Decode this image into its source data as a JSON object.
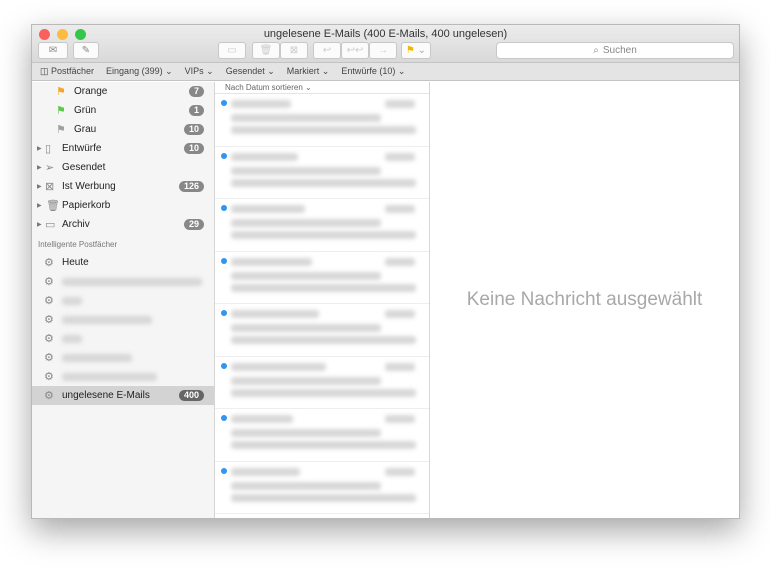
{
  "window": {
    "title": "ungelesene E-Mails (400 E-Mails, 400 ungelesen)"
  },
  "toolbar": {
    "search_placeholder": "Suchen"
  },
  "favorites": [
    "Postfächer",
    "Eingang (399) ⌄",
    "VIPs ⌄",
    "Gesendet ⌄",
    "Markiert ⌄",
    "Entwürfe (10) ⌄"
  ],
  "sidebar": {
    "flags": [
      {
        "label": "Orange",
        "count": "7",
        "color": "#f5a623"
      },
      {
        "label": "Grün",
        "count": "1",
        "color": "#5ccb4a"
      },
      {
        "label": "Grau",
        "count": "10",
        "color": "#a0a0a0"
      }
    ],
    "mailboxes": [
      {
        "label": "Entwürfe",
        "count": "10",
        "icon": "📄"
      },
      {
        "label": "Gesendet",
        "count": "",
        "icon": "➢"
      },
      {
        "label": "Ist Werbung",
        "count": "126",
        "icon": "🗳"
      },
      {
        "label": "Papierkorb",
        "count": "",
        "icon": "🗑"
      },
      {
        "label": "Archiv",
        "count": "29",
        "icon": "🗃"
      }
    ],
    "smart_header": "Intelligente Postfächer",
    "smart_first": "Heute",
    "smart_selected": {
      "label": "ungelesene E-Mails",
      "count": "400"
    }
  },
  "list": {
    "sort_label": "Nach Datum sortieren ⌄"
  },
  "detail": {
    "empty": "Keine Nachricht ausgewählt"
  }
}
